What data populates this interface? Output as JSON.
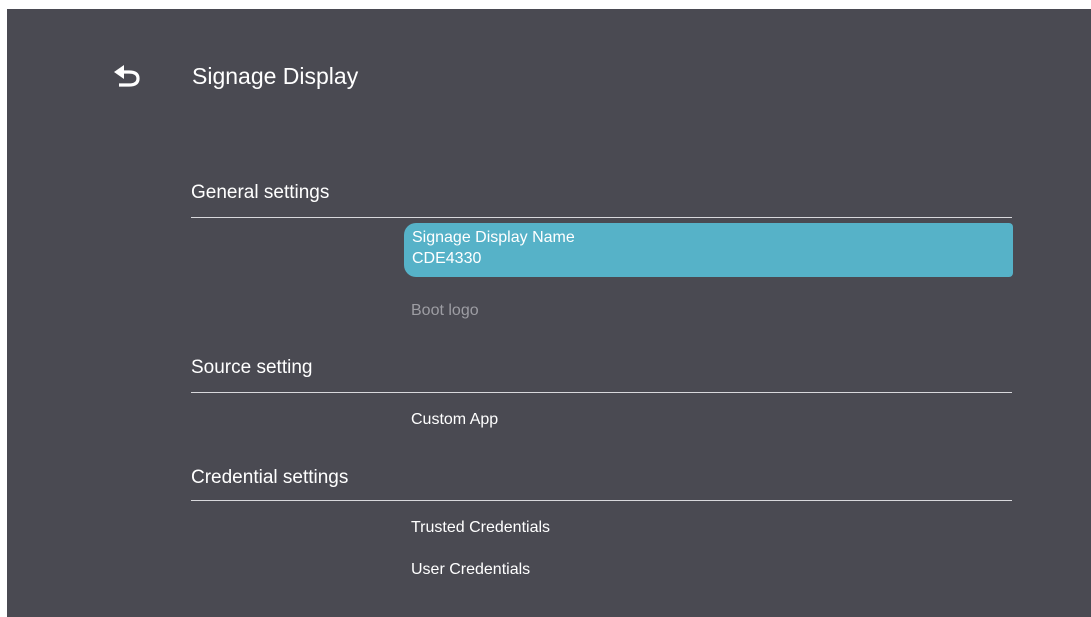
{
  "header": {
    "title": "Signage Display",
    "back_icon": "back-arrow-icon"
  },
  "colors": {
    "background": "#4a4a52",
    "selection": "#56b2c8",
    "text": "#ffffff",
    "disabled_text": "#9d9da3"
  },
  "sections": {
    "general": {
      "title": "General settings",
      "display_name": {
        "label": "Signage Display Name",
        "value": "CDE4330"
      },
      "boot_logo": {
        "label": "Boot logo"
      }
    },
    "source": {
      "title": "Source setting",
      "custom_app": {
        "label": "Custom App"
      }
    },
    "credential": {
      "title": "Credential settings",
      "trusted": {
        "label": "Trusted Credentials"
      },
      "user": {
        "label": "User Credentials"
      }
    }
  }
}
